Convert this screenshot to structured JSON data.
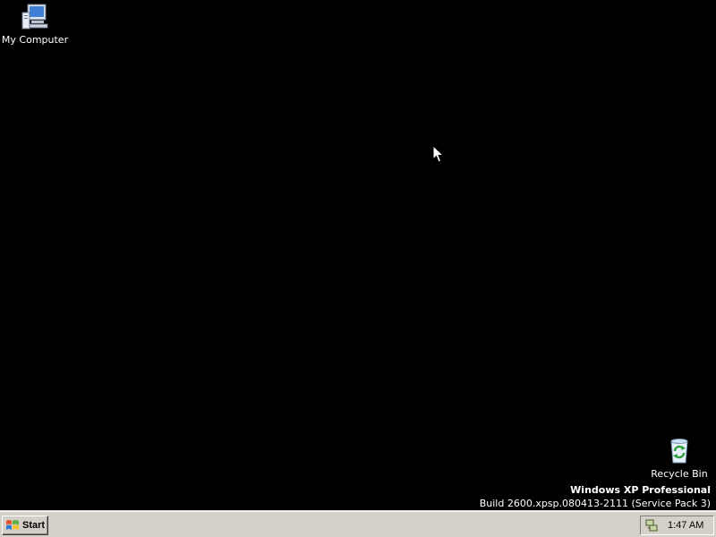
{
  "desktop": {
    "background": "#000000",
    "icons": [
      {
        "label": "My Computer",
        "icon": "my-computer-icon"
      },
      {
        "label": "Recycle Bin",
        "icon": "recycle-bin-icon"
      }
    ],
    "watermark": {
      "edition": "Windows XP Professional",
      "build": "Build 2600.xpsp.080413-2111 (Service Pack 3)"
    }
  },
  "taskbar": {
    "background": "#d4d0c8",
    "start_label": "Start",
    "tray": {
      "icon": "network-icon",
      "clock": "1:47 AM"
    }
  }
}
